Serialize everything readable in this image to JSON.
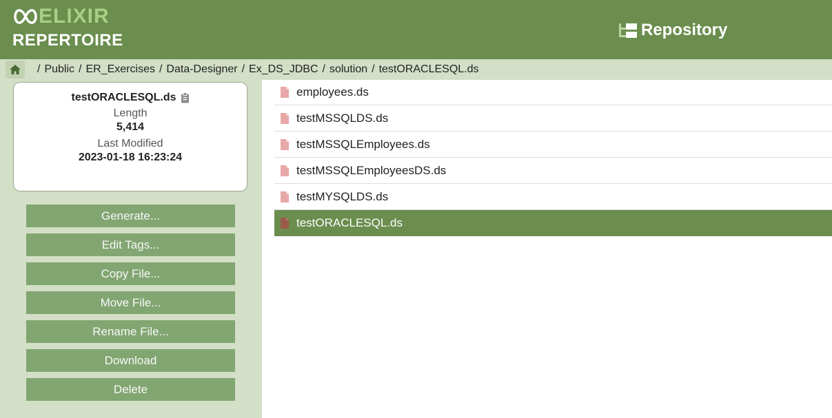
{
  "header": {
    "logo_top": "ELIXIR",
    "logo_bottom": "REPERTOIRE",
    "title": "Repository",
    "title_icon": "tree-icon",
    "accent_color": "#6b8e4e"
  },
  "breadcrumb": {
    "home_icon": "home-icon",
    "items": [
      "Public",
      "ER_Exercises",
      "Data-Designer",
      "Ex_DS_JDBC",
      "solution",
      "testORACLESQL.ds"
    ],
    "separator": "/"
  },
  "details": {
    "file_name": "testORACLESQL.ds",
    "length_label": "Length",
    "length_value": "5,414",
    "modified_label": "Last Modified",
    "modified_value": "2023-01-18 16:23:24"
  },
  "actions": [
    "Generate...",
    "Edit Tags...",
    "Copy File...",
    "Move File...",
    "Rename File...",
    "Download",
    "Delete"
  ],
  "files": [
    {
      "name": "employees.ds",
      "selected": false
    },
    {
      "name": "testMSSQLDS.ds",
      "selected": false
    },
    {
      "name": "testMSSQLEmployees.ds",
      "selected": false
    },
    {
      "name": "testMSSQLEmployeesDS.ds",
      "selected": false
    },
    {
      "name": "testMYSQLDS.ds",
      "selected": false
    },
    {
      "name": "testORACLESQL.ds",
      "selected": true
    }
  ]
}
